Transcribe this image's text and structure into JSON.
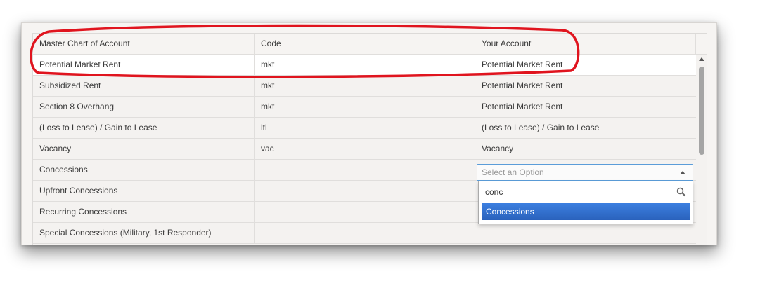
{
  "columns": {
    "master": "Master Chart of Account",
    "code": "Code",
    "your_account": "Your Account"
  },
  "rows": [
    {
      "master": "Potential Market Rent",
      "code": "mkt",
      "your_account": "Potential Market Rent"
    },
    {
      "master": "Subsidized Rent",
      "code": "mkt",
      "your_account": "Potential Market Rent"
    },
    {
      "master": "Section 8 Overhang",
      "code": "mkt",
      "your_account": "Potential Market Rent"
    },
    {
      "master": "(Loss to Lease) / Gain to Lease",
      "code": "ltl",
      "your_account": "(Loss to Lease) / Gain to Lease"
    },
    {
      "master": "Vacancy",
      "code": "vac",
      "your_account": "Vacancy"
    },
    {
      "master": "Concessions",
      "code": "",
      "your_account": ""
    },
    {
      "master": "Upfront Concessions",
      "code": "",
      "your_account": ""
    },
    {
      "master": "Recurring Concessions",
      "code": "",
      "your_account": ""
    },
    {
      "master": "Special Concessions (Military, 1st Responder)",
      "code": "",
      "your_account": ""
    }
  ],
  "select": {
    "placeholder": "Select an Option",
    "search_value": "conc",
    "options": [
      "Concessions"
    ]
  },
  "colors": {
    "annotation": "#e0141e",
    "select_border": "#5b9dd9",
    "option_highlight": "#3875d7"
  },
  "icons": [
    "search-icon",
    "chevron-up-icon",
    "scroll-up-icon"
  ]
}
